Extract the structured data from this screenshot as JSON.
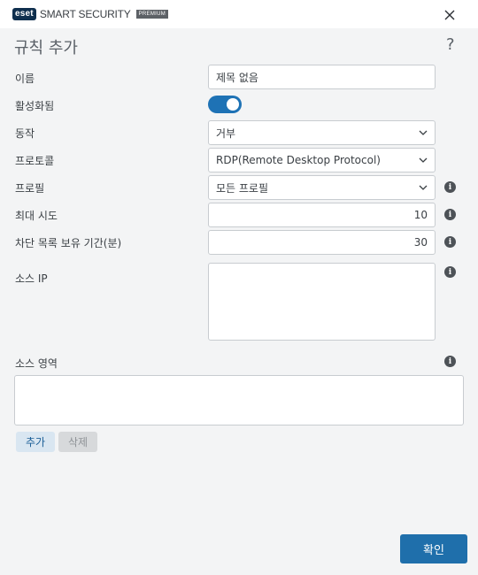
{
  "titlebar": {
    "logo_text": "eset",
    "product_name": "SMART SECURITY",
    "edition": "PREMIUM"
  },
  "dialog": {
    "title": "규칙 추가",
    "help": "?"
  },
  "form": {
    "name": {
      "label": "이름",
      "value": "제목 없음"
    },
    "enabled": {
      "label": "활성화됨",
      "value": true
    },
    "action": {
      "label": "동작",
      "value": "거부"
    },
    "protocol": {
      "label": "프로토콜",
      "value": "RDP(Remote Desktop Protocol)"
    },
    "profile": {
      "label": "프로필",
      "value": "모든 프로필"
    },
    "max_attempts": {
      "label": "최대 시도",
      "value": "10"
    },
    "blocklist_retention": {
      "label": "차단 목록 보유 기간(분)",
      "value": "30"
    },
    "source_ip": {
      "label": "소스 IP",
      "value": ""
    },
    "source_zone": {
      "label": "소스 영역",
      "value": ""
    }
  },
  "buttons": {
    "add": "추가",
    "delete": "삭제",
    "ok": "확인"
  },
  "icons": {
    "info": "i",
    "close": "close-icon",
    "chevron": "chevron-down-icon"
  },
  "colors": {
    "accent": "#1f6fab",
    "toggle_on": "#1e72b5",
    "logo_bg": "#0f2f4e"
  }
}
